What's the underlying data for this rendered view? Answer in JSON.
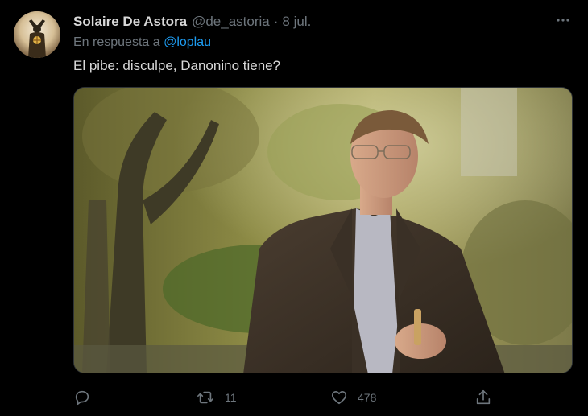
{
  "tweet": {
    "display_name": "Solaire De Astora",
    "handle": "@de_astoria",
    "separator": "·",
    "date": "8 jul.",
    "reply_prefix": "En respuesta a",
    "reply_to": "@loplau",
    "text": "El pibe: disculpe, Danonino tiene?",
    "media": {
      "kind": "photo"
    }
  },
  "actions": {
    "reply": {
      "icon": "reply-icon",
      "count": ""
    },
    "retweet": {
      "icon": "retweet-icon",
      "count": "11"
    },
    "like": {
      "icon": "heart-icon",
      "count": "478"
    },
    "share": {
      "icon": "share-icon",
      "count": ""
    }
  },
  "colors": {
    "background": "#000000",
    "text": "#d9d9d9",
    "muted": "#6e767d",
    "link": "#1d9bf0"
  }
}
